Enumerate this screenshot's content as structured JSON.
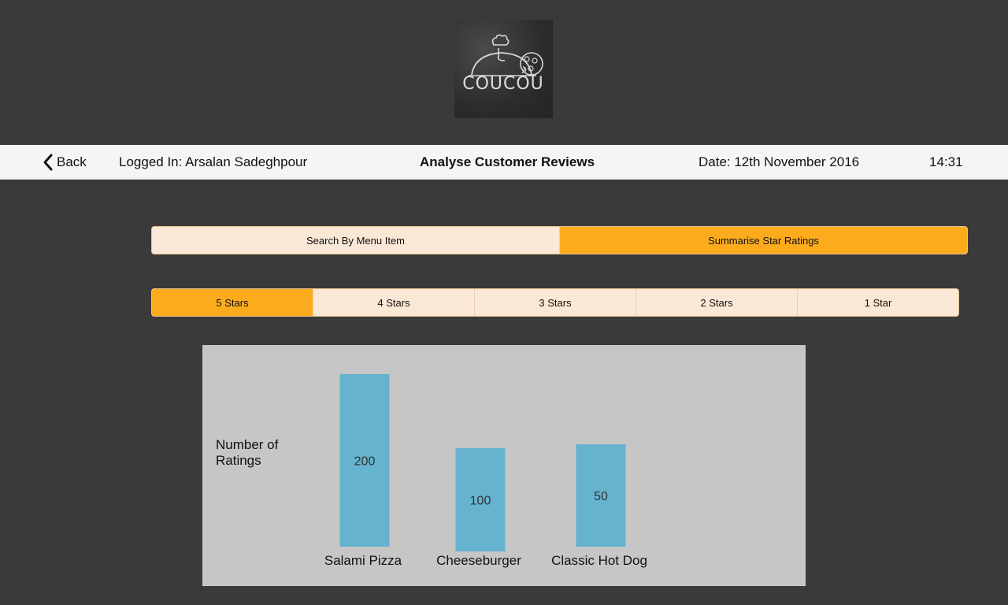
{
  "logo": {
    "text": "COUCOU"
  },
  "header": {
    "back_label": "Back",
    "logged_in": "Logged In: Arsalan Sadeghpour",
    "title": "Analyse Customer Reviews",
    "date": "Date: 12th November 2016",
    "time": "14:31"
  },
  "view_tabs": [
    {
      "label": "Search By Menu Item",
      "active": false
    },
    {
      "label": "Summarise Star Ratings",
      "active": true
    }
  ],
  "star_tabs": [
    {
      "label": "5 Stars",
      "active": true
    },
    {
      "label": "4 Stars",
      "active": false
    },
    {
      "label": "3 Stars",
      "active": false
    },
    {
      "label": "2 Stars",
      "active": false
    },
    {
      "label": "1 Star",
      "active": false
    }
  ],
  "colors": {
    "active_tab": "#fcab1c",
    "inactive_tab": "#f9e8d5",
    "bar": "#65b3cf",
    "chart_bg": "#c6c6c6"
  },
  "chart_data": {
    "type": "bar",
    "categories": [
      "Salami Pizza",
      "Cheeseburger",
      "Classic Hot Dog"
    ],
    "values": [
      200,
      100,
      50
    ],
    "ylabel": "Number of Ratings",
    "xlabel": "",
    "title": ""
  }
}
